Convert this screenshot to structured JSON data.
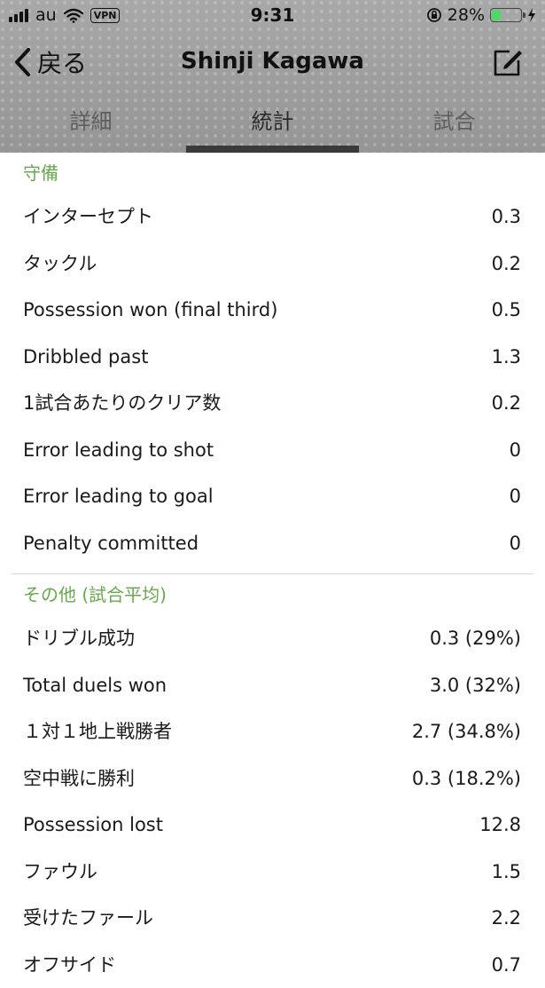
{
  "status_bar": {
    "carrier": "au",
    "vpn_label": "VPN",
    "time": "9:31",
    "battery_percent": "28%",
    "battery_level": 0.28,
    "signal_bars": 4,
    "icons": [
      "signal-icon",
      "wifi-icon",
      "orientation-lock-icon",
      "battery-icon",
      "charging-icon"
    ]
  },
  "nav": {
    "back_label": "戻る",
    "title": "Shinji Kagawa",
    "edit_icon": "compose-icon"
  },
  "tabs": [
    {
      "label": "詳細",
      "active": false
    },
    {
      "label": "統計",
      "active": true
    },
    {
      "label": "試合",
      "active": false
    }
  ],
  "colors": {
    "section_header": "#6aa84f",
    "tab_indicator": "#3a3a3a",
    "battery_fill": "#4cd964"
  },
  "sections": [
    {
      "title": "守備",
      "rows": [
        {
          "label": "インターセプト",
          "value": "0.3"
        },
        {
          "label": "タックル",
          "value": "0.2"
        },
        {
          "label": "Possession won (final third)",
          "value": "0.5"
        },
        {
          "label": "Dribbled past",
          "value": "1.3"
        },
        {
          "label": "1試合あたりのクリア数",
          "value": "0.2"
        },
        {
          "label": "Error leading to shot",
          "value": "0"
        },
        {
          "label": "Error leading to goal",
          "value": "0"
        },
        {
          "label": "Penalty committed",
          "value": "0"
        }
      ]
    },
    {
      "title": "その他 (試合平均)",
      "rows": [
        {
          "label": "ドリブル成功",
          "value": "0.3 (29%)"
        },
        {
          "label": "Total duels won",
          "value": "3.0 (32%)"
        },
        {
          "label": "１対１地上戦勝者",
          "value": "2.7 (34.8%)"
        },
        {
          "label": "空中戦に勝利",
          "value": "0.3 (18.2%)"
        },
        {
          "label": "Possession lost",
          "value": "12.8"
        },
        {
          "label": "ファウル",
          "value": "1.5"
        },
        {
          "label": "受けたファール",
          "value": "2.2"
        },
        {
          "label": "オフサイド",
          "value": "0.7"
        }
      ]
    }
  ]
}
